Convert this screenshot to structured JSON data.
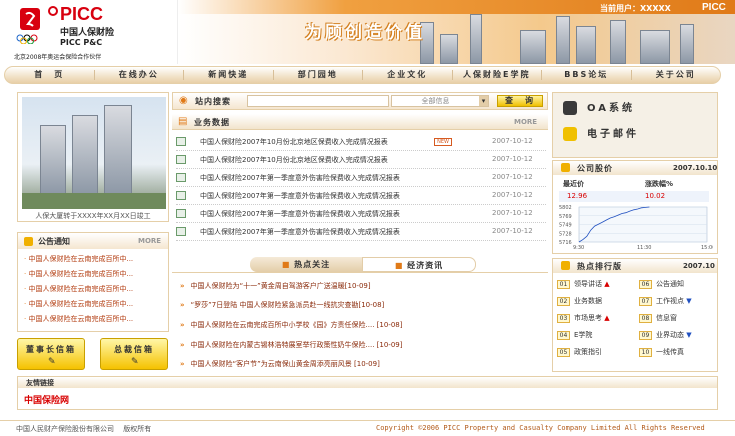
{
  "header": {
    "logo_text": "PICC",
    "company_cn": "中国人保财险",
    "company_en": "PICC P&C",
    "olympic_text": "Beijing 2008",
    "sponsor": "北京2008年奥运会保险合作伙伴",
    "slogan": "为顾创造价值",
    "current_user_label": "当前用户：XXXXX",
    "corner_logo": "PICC"
  },
  "nav": {
    "items": [
      "首　页",
      "在线办公",
      "新闻快递",
      "部门园地",
      "企业文化",
      "人保财险E学院",
      "BBS论坛",
      "关于公司"
    ]
  },
  "photo": {
    "caption": "人保大厦转于XXXX年XX月XX日竣工"
  },
  "notice": {
    "title": "公告通知",
    "more": "MORE",
    "items": [
      "中国人保财险在云南完成百所中...",
      "中国人保财险在云南完成百所中...",
      "中国人保财险在云南完成百所中...",
      "中国人保财险在云南完成百所中...",
      "中国人保财险在云南完成百所中..."
    ]
  },
  "buttons": {
    "chairman": "董事长信箱",
    "gm": "总裁信箱"
  },
  "search": {
    "title": "站内搜索",
    "select_value": "全部信息",
    "button": "查　询"
  },
  "biz": {
    "title": "业务数据",
    "more": "MORE",
    "new_badge": "NEW",
    "rows": [
      {
        "text": "中国人保财险2007年10月份北京地区保费收入完成情况报表",
        "date": "2007-10-12"
      },
      {
        "text": "中国人保财险2007年10月份北京地区保费收入完成情况报表",
        "date": "2007-10-12"
      },
      {
        "text": "中国人保财险2007年第一季度意外伤害险保费收入完成情况报表",
        "date": "2007-10-12"
      },
      {
        "text": "中国人保财险2007年第一季度意外伤害险保费收入完成情况报表",
        "date": "2007-10-12"
      },
      {
        "text": "中国人保财险2007年第一季度意外伤害险保费收入完成情况报表",
        "date": "2007-10-12"
      },
      {
        "text": "中国人保财险2007年第一季度意外伤害险保费收入完成情况报表",
        "date": "2007-10-12"
      }
    ]
  },
  "tabs": {
    "hot": "热点关注",
    "econ": "经济资讯"
  },
  "news": [
    "中国人保财险为“十一”黄金周自驾游客户广送温暖[10-09]",
    "“罗莎”7日登陆 中国人保财险紧急派员赴一线抗灾查勘[10-08]",
    "中国人保财险在云南完成百所中小学校《园》方责任保险.... [10-08]",
    "中国人保财险在内蒙古锡林浩特展室举行政策性奶牛保险.... [10-09]",
    "中国人保财险“客户节”为云南保山黄金周添亮丽风景 [10-09]"
  ],
  "quick": {
    "oa": "OA系统",
    "mail": "电子邮件"
  },
  "stock": {
    "title": "公司股价",
    "date": "2007.10.10",
    "latest_label": "最近价",
    "change_label": "涨跌幅%",
    "latest_value": "12.96",
    "change_value": "10.02",
    "yticks": [
      "5802",
      "5769",
      "5749",
      "5728",
      "5716"
    ],
    "xticks": [
      "9:30",
      "11:30",
      "15:00"
    ],
    "points": [
      5716,
      5722,
      5730,
      5745,
      5755,
      5760,
      5765,
      5770,
      5775,
      5778,
      5782,
      5786,
      5788,
      5792,
      5795,
      5797,
      5800,
      5801,
      5802
    ]
  },
  "rank": {
    "title": "热点排行版",
    "date": "2007.10",
    "items": [
      {
        "num": "01",
        "label": "领导讲话",
        "trend": "up"
      },
      {
        "num": "06",
        "label": "公告通知",
        "trend": ""
      },
      {
        "num": "02",
        "label": "业务数据",
        "trend": ""
      },
      {
        "num": "07",
        "label": "工作视点",
        "trend": "down"
      },
      {
        "num": "03",
        "label": "市场思考",
        "trend": "up"
      },
      {
        "num": "08",
        "label": "信息窗",
        "trend": ""
      },
      {
        "num": "04",
        "label": "E学院",
        "trend": ""
      },
      {
        "num": "09",
        "label": "业界动态",
        "trend": "down"
      },
      {
        "num": "05",
        "label": "政策指引",
        "trend": ""
      },
      {
        "num": "10",
        "label": "一线传真",
        "trend": ""
      }
    ]
  },
  "links": {
    "title": "友情链接",
    "logo": "中国保险网"
  },
  "footer": {
    "left": "中国人民财产保险股份有限公司　 版权所有",
    "right": "Copyright ©2006 PICC Property and Casualty Company Limited All Rights Reserved"
  },
  "colors": {
    "brand_red": "#d8000f",
    "accent_orange": "#e07a18",
    "beige": "#f2e4cc"
  }
}
